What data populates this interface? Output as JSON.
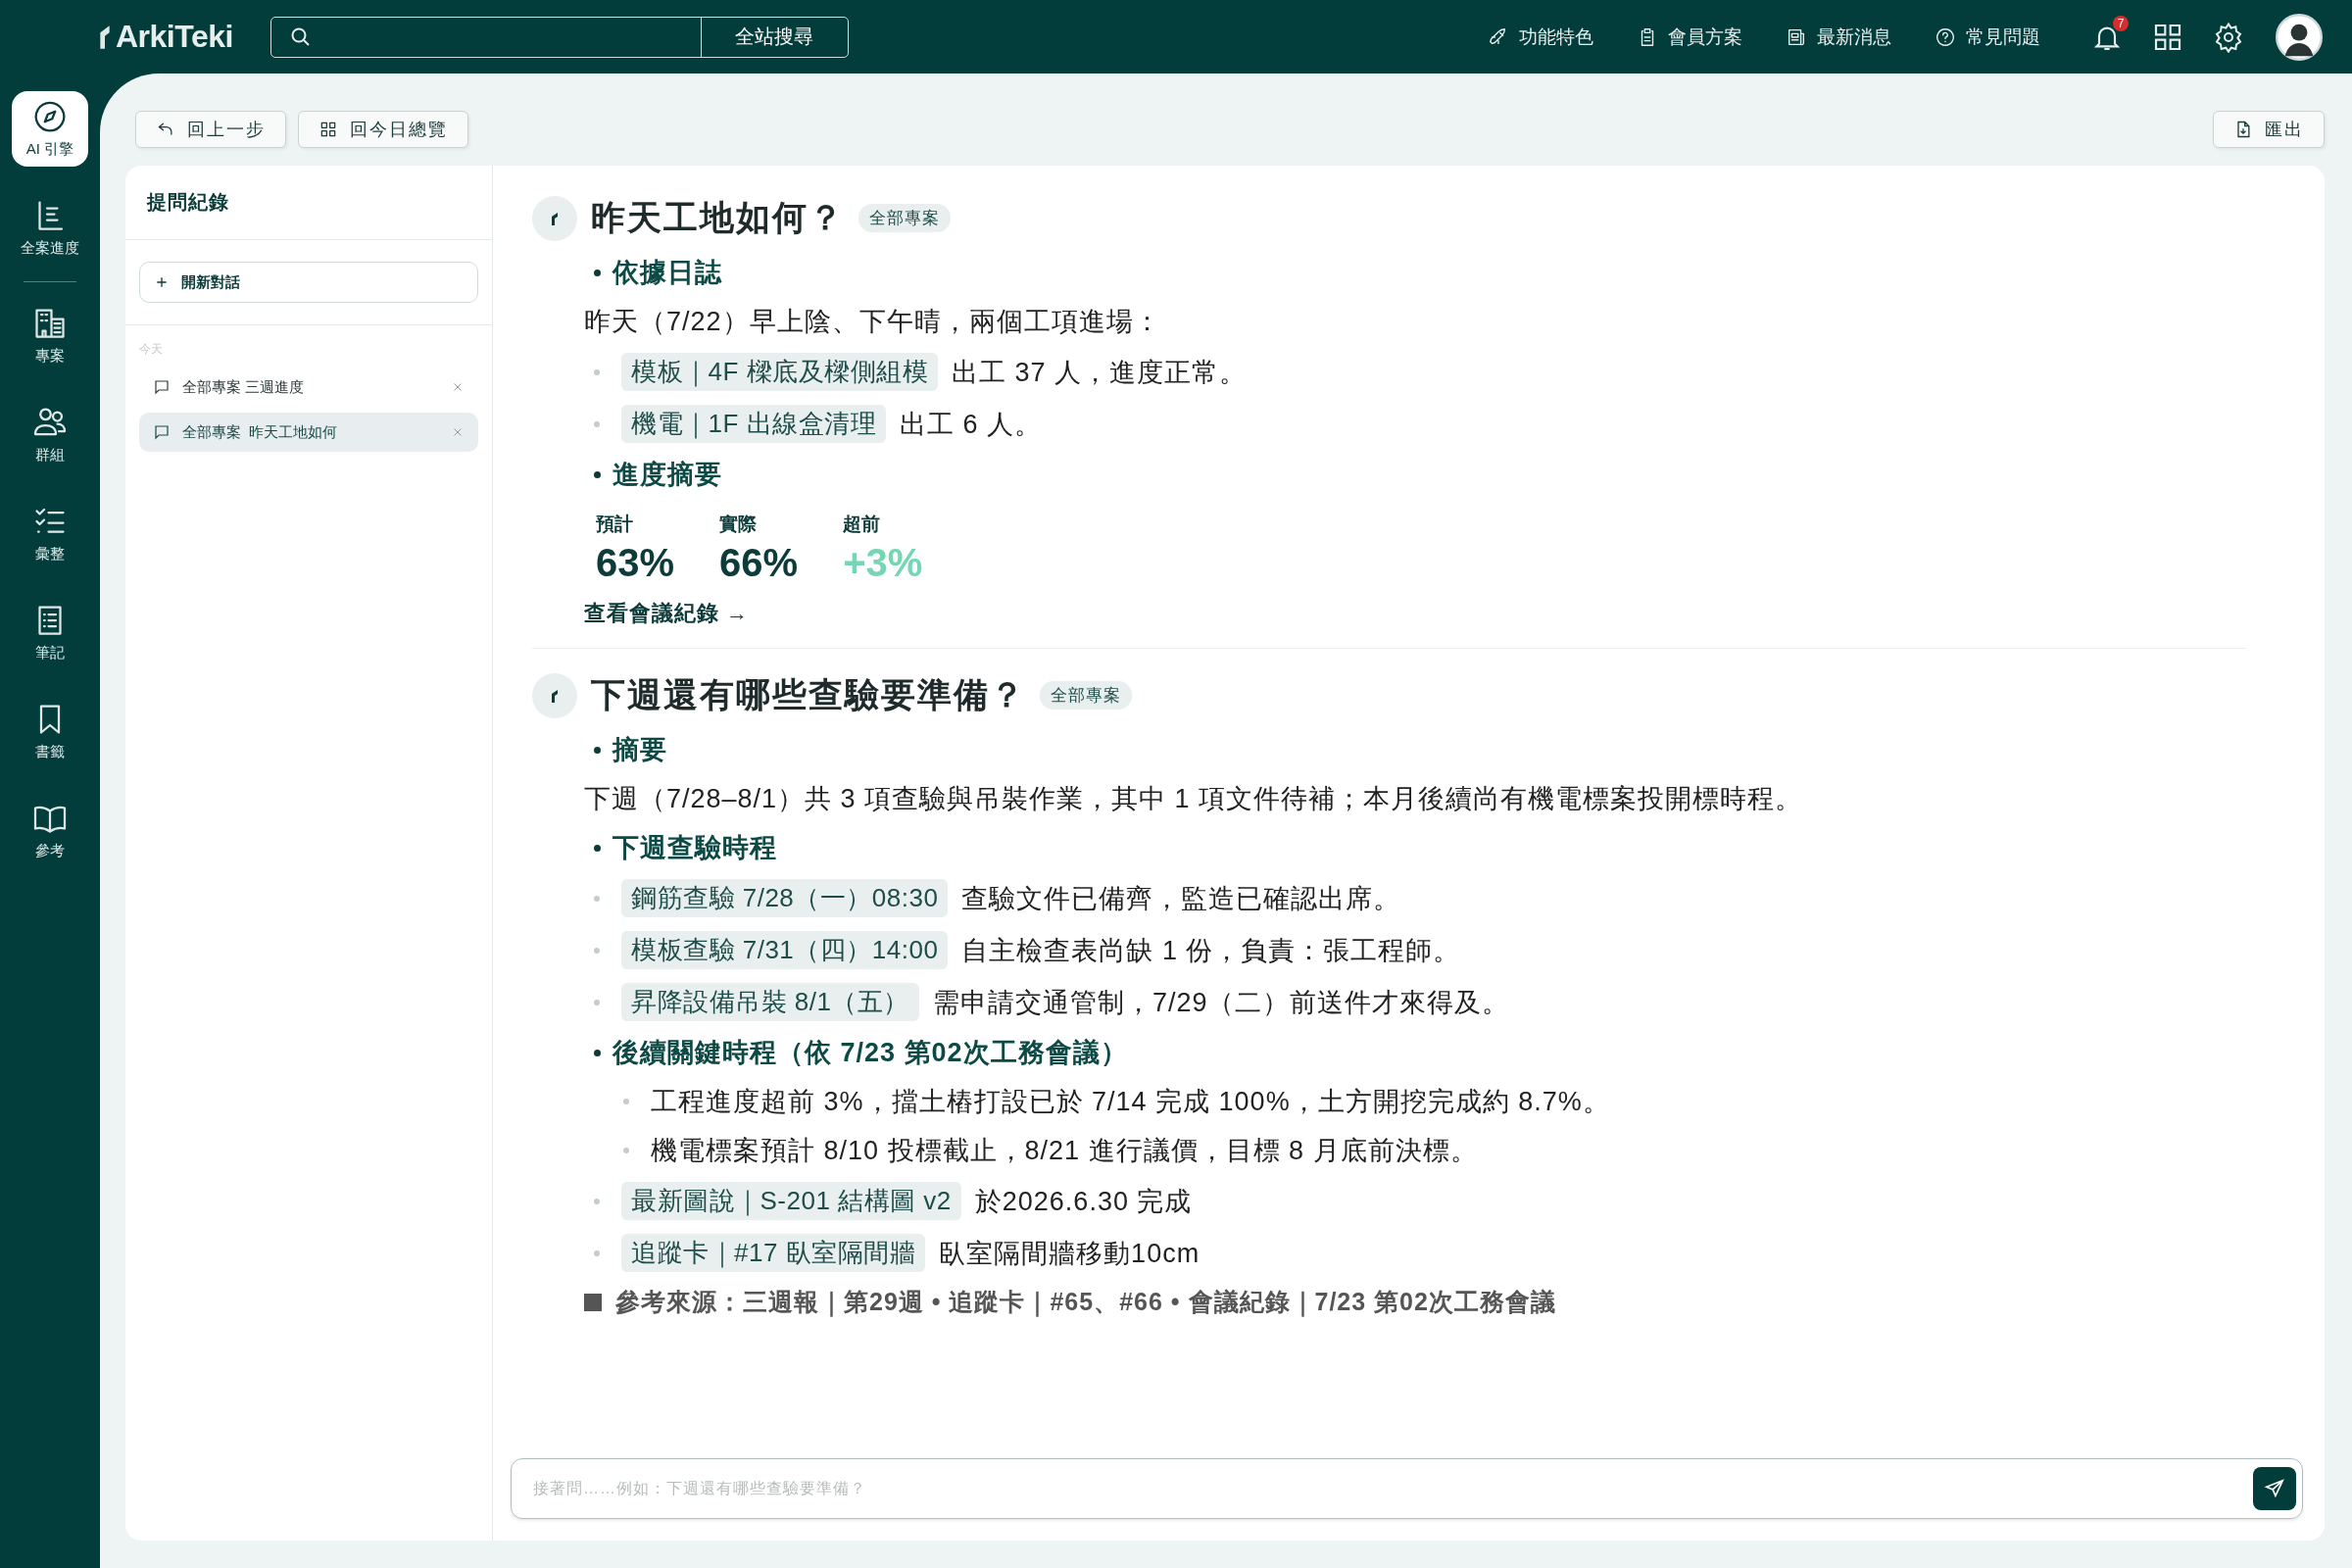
{
  "topbar": {
    "logo": "ArkiTeki",
    "search": {
      "button": "全站搜尋"
    },
    "nav": [
      {
        "label": "功能特色"
      },
      {
        "label": "會員方案"
      },
      {
        "label": "最新消息"
      },
      {
        "label": "常見問題"
      }
    ],
    "notification_count": "7"
  },
  "rail": [
    {
      "label": "AI 引擎",
      "selected": true
    },
    {
      "label": "全案進度",
      "selected": false
    },
    {
      "label": "專案",
      "selected": false
    },
    {
      "label": "群組",
      "selected": false
    },
    {
      "label": "彙整",
      "selected": false
    },
    {
      "label": "筆記",
      "selected": false
    },
    {
      "label": "書籤",
      "selected": false
    },
    {
      "label": "參考",
      "selected": false
    }
  ],
  "toolbar": {
    "buttons": [
      {
        "label": "回上一步"
      },
      {
        "label": "回今日總覽"
      }
    ],
    "export": "匯出"
  },
  "history": {
    "title": "提問紀錄",
    "new_chat": "開新對話",
    "group": "今天",
    "items": [
      {
        "label": "全部專案 三週進度",
        "selected": false
      },
      {
        "label": "全部專案  昨天工地如何",
        "selected": true
      }
    ]
  },
  "answers": [
    {
      "question": "昨天工地如何？",
      "scope": "全部專案",
      "blocks": [
        {
          "kind": "heading",
          "text": "依據日誌"
        },
        {
          "kind": "paragraph",
          "text": "昨天（7/22）早上陰、下午晴，兩個工項進場："
        },
        {
          "kind": "bullet",
          "tag": "模板｜4F 樑底及樑側組模",
          "text": "出工 37 人，進度正常。"
        },
        {
          "kind": "bullet",
          "tag": "機電｜1F 出線盒清理",
          "text": "出工 6 人。"
        },
        {
          "kind": "heading",
          "text": "進度摘要"
        },
        {
          "kind": "stats",
          "items": [
            {
              "label": "預計",
              "value": "63%",
              "color": "#0d3b3a"
            },
            {
              "label": "實際",
              "value": "66%",
              "color": "#0d3b3a"
            },
            {
              "label": "超前",
              "value": "+3%",
              "color": "#74d6b3"
            }
          ]
        },
        {
          "kind": "link",
          "text": "查看會議紀錄 →"
        }
      ]
    },
    {
      "question": "下週還有哪些查驗要準備？",
      "scope": "全部專案",
      "blocks": [
        {
          "kind": "heading",
          "text": "摘要"
        },
        {
          "kind": "paragraph",
          "text": "下週（7/28–8/1）共 3 項查驗與吊裝作業，其中 1 項文件待補；本月後續尚有機電標案投開標時程。"
        },
        {
          "kind": "heading",
          "text": "下週查驗時程"
        },
        {
          "kind": "bullet",
          "tag": "鋼筋查驗 7/28（一）08:30",
          "text": "查驗文件已備齊，監造已確認出席。"
        },
        {
          "kind": "bullet",
          "tag": "模板查驗 7/31（四）14:00",
          "text": "自主檢查表尚缺 1 份，負責：張工程師。"
        },
        {
          "kind": "bullet",
          "tag": "昇降設備吊裝 8/1（五）",
          "text": "需申請交通管制，7/29（二）前送件才來得及。"
        },
        {
          "kind": "heading",
          "text": "後續關鍵時程（依 7/23 第02次工務會議）",
          "children": [
            {
              "text": "工程進度超前 3%，擋土樁打設已於 7/14 完成 100%，土方開挖完成約 8.7%。"
            },
            {
              "text": "機電標案預計 8/10 投標截止，8/21 進行議價，目標 8 月底前決標。"
            }
          ]
        },
        {
          "kind": "bullet",
          "tag": "最新圖說｜S-201 結構圖 v2",
          "text": "於2026.6.30 完成"
        },
        {
          "kind": "bullet",
          "tag": "追蹤卡｜#17 臥室隔間牆",
          "text": "臥室隔間牆移動10cm"
        },
        {
          "kind": "sources",
          "text": "參考來源：三週報｜第29週 • 追蹤卡｜#65、#66 • 會議紀錄｜7/23 第02次工務會議"
        }
      ]
    }
  ],
  "composer": {
    "placeholder": "接著問……例如：下週還有哪些查驗要準備？"
  }
}
